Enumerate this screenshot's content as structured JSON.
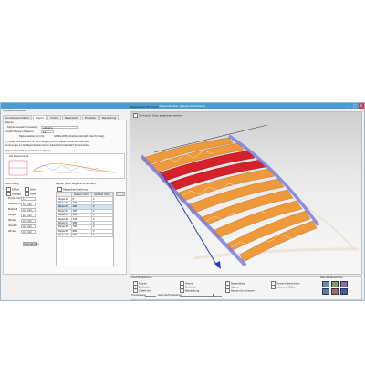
{
  "window": {
    "title": "Rippenfenster (Rippendatenbank)",
    "controls": [
      "–",
      "□",
      "×"
    ]
  },
  "left": {
    "group_title": "Rippeneditor/Arbeit",
    "tabs": [
      {
        "label": "Grundeigenschaften"
      },
      {
        "label": "Rippen",
        "active": true
      },
      {
        "label": "Holme"
      },
      {
        "label": "Nasenleiste"
      },
      {
        "label": "Endleiste"
      },
      {
        "label": "Beplankung"
      },
      {
        "label": "Ausfräsen"
      }
    ],
    "section_rippen": "Rippen",
    "label_rippenauswahl": "Rippenauswahl (Auswahl)",
    "rippenauswahl_value": "Aktuelle",
    "label_anzahl": "Anzahl Rippen (Rippen)",
    "anzahl_value": "14",
    "label_abstand": "Rippenabstand (mm)",
    "abstand_value": "[WING-RIB] (Abstand/Verteilt Gleichmäßig)",
    "info_line1": "(*) Diese Parameter sind für die Erzeugung (extra) Rippen verwendet. Manuelle",
    "info_line2": "Änderungen an der Rippentabelle können diesen Parameter-Wert überschreiben.",
    "preview_title": "Rippenübersicht (Auswahl einer Rippe)",
    "preview_subtitle": "Alle Rippenansicht",
    "profil_title": "Ausrichtung",
    "profil_rows": [
      {
        "label": "Offset",
        "value": "Holm"
      },
      {
        "label": "Auflage",
        "value": "Höhe"
      }
    ],
    "params": [
      {
        "label": "Dicke (mm)",
        "value": "1.5"
      },
      {
        "label": "Breite (mm)",
        "value": "0.0 mm"
      },
      {
        "label": "Breite B",
        "value": "0.0 mm"
      },
      {
        "label": "Länge",
        "value": "0.0 mm"
      },
      {
        "label": "Winkel",
        "value": "0.0 mm"
      },
      {
        "label": "Versatz",
        "value": "0.0 mm"
      },
      {
        "label": "Winkel",
        "value": "0.0 mm"
      }
    ],
    "table_title": "Rippen (auch abgetrennt werden)",
    "table_subtitle": "Rippenbeschreibung",
    "table_head": [
      "",
      "Position (mm)",
      "Sichtbar (mm)"
    ],
    "table_rows": [
      [
        "Rippe 01",
        "0",
        "0"
      ],
      [
        "Rippe 02",
        "100",
        "0"
      ],
      [
        "Rippe 03",
        "200",
        "0"
      ],
      [
        "Rippe 04",
        "300",
        "0"
      ],
      [
        "Rippe 05",
        "400",
        "0"
      ],
      [
        "Rippe 06",
        "500",
        "0"
      ],
      [
        "Rippe 07",
        "600",
        "0"
      ],
      [
        "Rippe 08",
        "700",
        "0"
      ],
      [
        "Rippe 09",
        "800",
        "0"
      ],
      [
        "Rippe 10",
        "900",
        "0"
      ]
    ],
    "btn_apply": "Übernehmen",
    "btn_reset": "Zurücksetzen"
  },
  "view": {
    "title": "Rippenansicht 3D Ansicht",
    "checkbox_label": "3D Ansicht (Auto abgerissen werden)"
  },
  "bottom": {
    "col1_title": "Ansichtsoptionen",
    "col1_items": [
      "Rippen",
      "Endleiste",
      "Gitterlinie"
    ],
    "col2_title": "",
    "col2_items": [
      "Holme",
      "Endleiste",
      "Beplankung"
    ],
    "col3_items": [
      "Nasenleiste",
      "Rippen",
      "Rippendurchmesser"
    ],
    "col4_items": [
      "Beplankung",
      "Ausfräsen",
      "Profilkontur"
    ],
    "col5_items": [
      "Gesamtübersichten",
      "Achsen in Gitter"
    ],
    "col6_title": "Standardansichten",
    "slider1_label": "Transparenz",
    "slider2_label": "Gamma/Transparenz"
  },
  "colors": {
    "rib_orange": "#ef9a3a",
    "rib_red": "#d6212a",
    "spar_purple": "#7b7fd8",
    "arrow_blue": "#2d3fb0",
    "title_blue": "#4a9bd1"
  }
}
